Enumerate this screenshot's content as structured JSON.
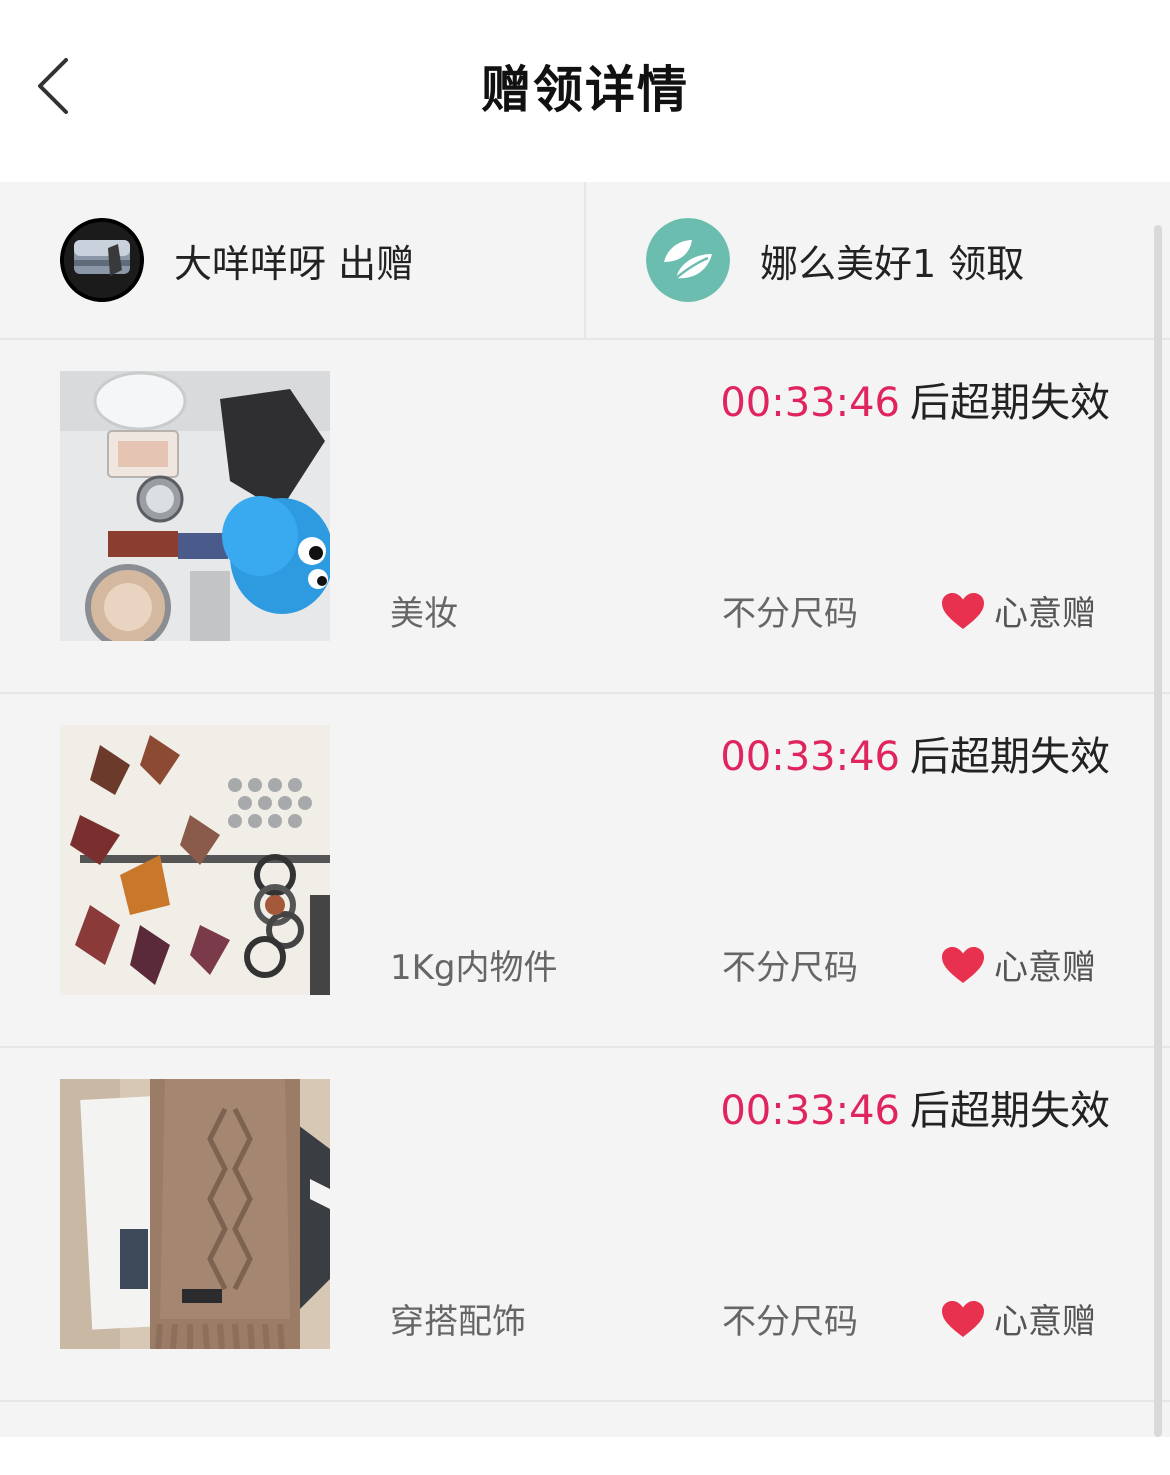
{
  "header": {
    "title": "赠领详情",
    "back_icon": "chevron-left-icon"
  },
  "users": {
    "giver": {
      "label": "大咩咩呀 出赠"
    },
    "receiver": {
      "label": "娜么美好1 领取"
    }
  },
  "items": [
    {
      "countdown": "00:33:46",
      "countdown_suffix": "后超期失效",
      "category": "美妆",
      "size": "不分尺码",
      "gift_type": "心意赠"
    },
    {
      "countdown": "00:33:46",
      "countdown_suffix": "后超期失效",
      "category": "1Kg内物件",
      "size": "不分尺码",
      "gift_type": "心意赠"
    },
    {
      "countdown": "00:33:46",
      "countdown_suffix": "后超期失效",
      "category": "穿搭配饰",
      "size": "不分尺码",
      "gift_type": "心意赠"
    }
  ],
  "colors": {
    "accent": "#e0245e",
    "heart": "#e8304f",
    "background": "#f4f4f4",
    "receiver_avatar": "#6bbdb0"
  }
}
